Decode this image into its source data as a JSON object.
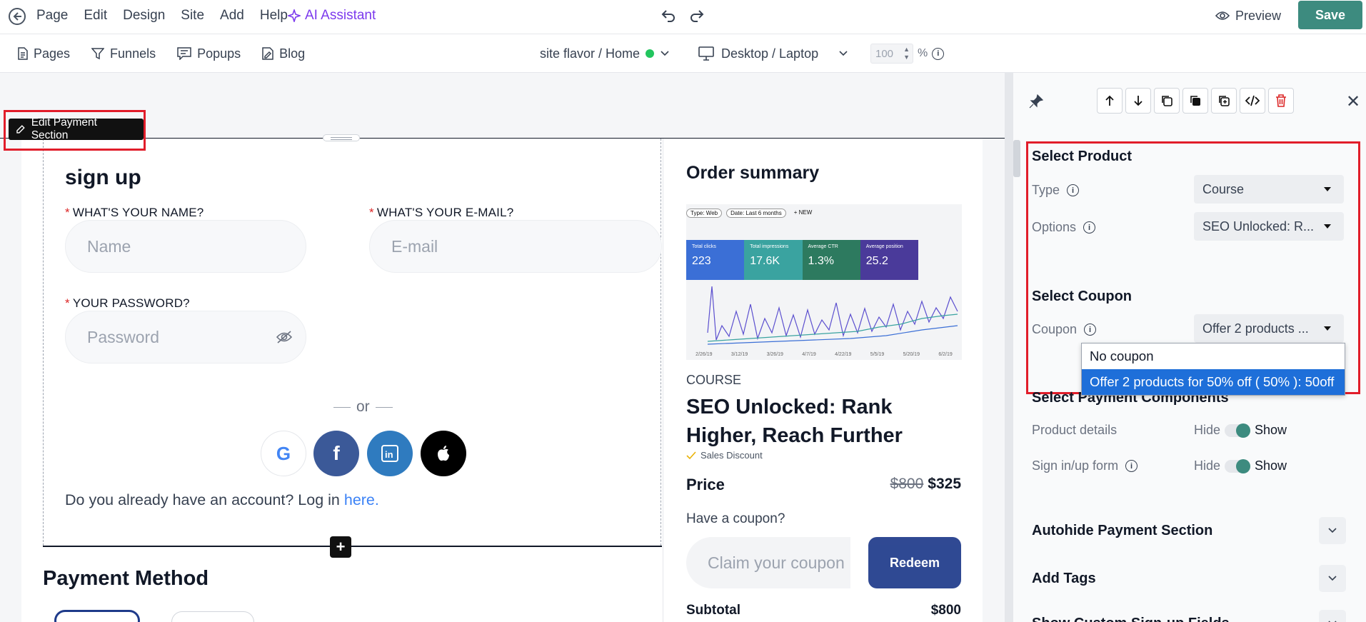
{
  "topbar": {
    "menu": [
      "Page",
      "Edit",
      "Design",
      "Site",
      "Add",
      "Help"
    ],
    "ai_label": "AI Assistant",
    "preview_label": "Preview",
    "save_label": "Save"
  },
  "subbar": {
    "nav": [
      "Pages",
      "Funnels",
      "Popups",
      "Blog"
    ],
    "site_selector": "site flavor / Home",
    "device_selector": "Desktop / Laptop",
    "zoom_value": "100",
    "zoom_unit": "%"
  },
  "canvas": {
    "edit_tag": "Edit Payment Section",
    "signup": {
      "title": "sign up",
      "name_label": "WHAT'S YOUR NAME?",
      "name_placeholder": "Name",
      "email_label": "WHAT'S YOUR E-MAIL?",
      "email_placeholder": "E-mail",
      "password_label": "YOUR PASSWORD?",
      "password_placeholder": "Password",
      "required_mark": "*",
      "or_text": "or",
      "login_prefix": "Do you already have an account? Log in ",
      "login_link": "here."
    },
    "payment_method_title": "Payment Method",
    "order": {
      "title": "Order summary",
      "thumb": {
        "pills": [
          "Type: Web",
          "Date: Last 6 months",
          "+ NEW"
        ],
        "tiles": [
          {
            "label": "Total clicks",
            "value": "223",
            "color": "#3b6fd6"
          },
          {
            "label": "Total impressions",
            "value": "17.6K",
            "color": "#3aa3a0"
          },
          {
            "label": "Average CTR",
            "value": "1.3%",
            "color": "#2d7a5f"
          },
          {
            "label": "Average position",
            "value": "25.2",
            "color": "#4a3a9a"
          }
        ],
        "dates": [
          "2/26/19",
          "3/12/19",
          "3/26/19",
          "4/7/19",
          "4/22/19",
          "5/5/19",
          "5/20/19",
          "6/2/19"
        ]
      },
      "course_tag": "COURSE",
      "course_name": "SEO Unlocked: Rank Higher, Reach Further",
      "discount_label": "Sales Discount",
      "price_label": "Price",
      "price_old": "$800",
      "price_new": "$325",
      "coupon_question": "Have a coupon?",
      "coupon_placeholder": "Claim your coupon",
      "redeem_label": "Redeem",
      "subtotal_label": "Subtotal",
      "subtotal_value": "$800"
    }
  },
  "panel": {
    "select_product_title": "Select Product",
    "type_label": "Type",
    "type_value": "Course",
    "options_label": "Options",
    "options_value": "SEO Unlocked: R...",
    "select_coupon_title": "Select Coupon",
    "coupon_label": "Coupon",
    "coupon_value": "Offer 2 products ...",
    "coupon_options": [
      "No coupon",
      "Offer 2 products for 50% off ( 50% ): 50off"
    ],
    "payment_components_title": "Select Payment Components",
    "product_details_label": "Product details",
    "signin_form_label": "Sign in/up form",
    "hide_label": "Hide",
    "show_label": "Show",
    "accordions": [
      "Autohide Payment Section",
      "Add Tags",
      "Show Custom Sign-up Fields"
    ]
  },
  "colors": {
    "brand_save": "#3d8b7f",
    "ai_purple": "#7c3aed",
    "highlight_red": "#e11d2a",
    "redeem_blue": "#1e3a8a",
    "dropdown_selected": "#1e6fd9"
  }
}
